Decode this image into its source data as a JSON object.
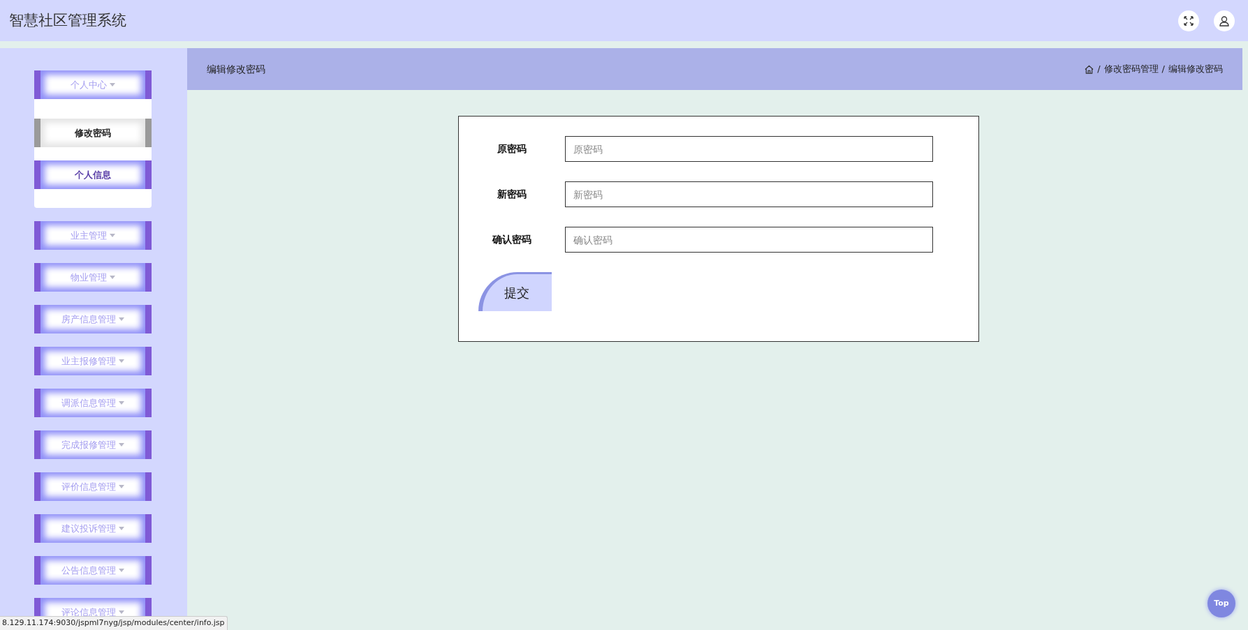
{
  "header": {
    "title": "智慧社区管理系统"
  },
  "sidebar": {
    "items": [
      {
        "label": "个人中心",
        "expanded": true,
        "children": [
          {
            "label": "修改密码",
            "selected": true
          },
          {
            "label": "个人信息",
            "selected": false
          }
        ]
      },
      {
        "label": "业主管理",
        "expanded": false
      },
      {
        "label": "物业管理",
        "expanded": false
      },
      {
        "label": "房产信息管理",
        "expanded": false
      },
      {
        "label": "业主报修管理",
        "expanded": false
      },
      {
        "label": "调派信息管理",
        "expanded": false
      },
      {
        "label": "完成报修管理",
        "expanded": false
      },
      {
        "label": "评价信息管理",
        "expanded": false
      },
      {
        "label": "建议投诉管理",
        "expanded": false
      },
      {
        "label": "公告信息管理",
        "expanded": false
      },
      {
        "label": "评论信息管理",
        "expanded": false
      }
    ]
  },
  "page_header": {
    "title": "编辑修改密码",
    "breadcrumb": [
      {
        "separator": "/",
        "label": "修改密码管理"
      },
      {
        "separator": "/",
        "label": "编辑修改密码"
      }
    ]
  },
  "form": {
    "fields": [
      {
        "label": "原密码",
        "placeholder": "原密码"
      },
      {
        "label": "新密码",
        "placeholder": "新密码"
      },
      {
        "label": "确认密码",
        "placeholder": "确认密码"
      }
    ],
    "submit": "提交"
  },
  "top_button": "Top",
  "status_bar": "8.129.11.174:9030/jspml7nyg/jsp/modules/center/info.jsp"
}
